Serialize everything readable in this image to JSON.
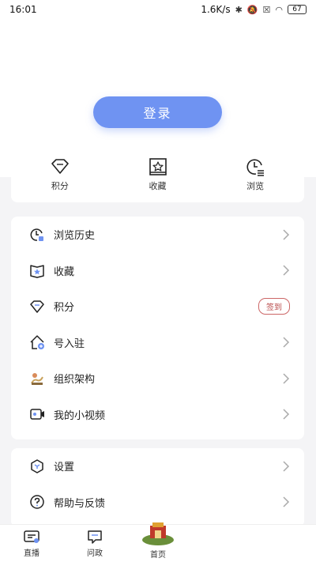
{
  "status_bar": {
    "time": "16:01",
    "speed": "1.6K/s",
    "battery": "67"
  },
  "hero": {
    "login_label": "登录"
  },
  "quick": [
    {
      "label": "积分",
      "icon": "diamond-icon"
    },
    {
      "label": "收藏",
      "icon": "star-box-icon"
    },
    {
      "label": "浏览",
      "icon": "clock-icon"
    }
  ],
  "menu_group_1": [
    {
      "label": "浏览历史",
      "icon": "clock-icon"
    },
    {
      "label": "收藏",
      "icon": "star-book-icon"
    },
    {
      "label": "积分",
      "icon": "diamond-icon",
      "badge": "签到"
    },
    {
      "label": "号入驻",
      "icon": "house-add-icon"
    },
    {
      "label": "组织架构",
      "icon": "org-image-icon"
    },
    {
      "label": "我的小视频",
      "icon": "video-icon"
    }
  ],
  "menu_group_2": [
    {
      "label": "设置",
      "icon": "settings-icon"
    },
    {
      "label": "帮助与反馈",
      "icon": "help-icon"
    }
  ],
  "tabs": [
    {
      "label": "直播",
      "icon": "live-icon"
    },
    {
      "label": "问政",
      "icon": "chat-icon"
    },
    {
      "label": "首页",
      "icon": "home-logo-icon"
    }
  ],
  "colors": {
    "accent": "#6f93f2",
    "badge": "#c66"
  }
}
